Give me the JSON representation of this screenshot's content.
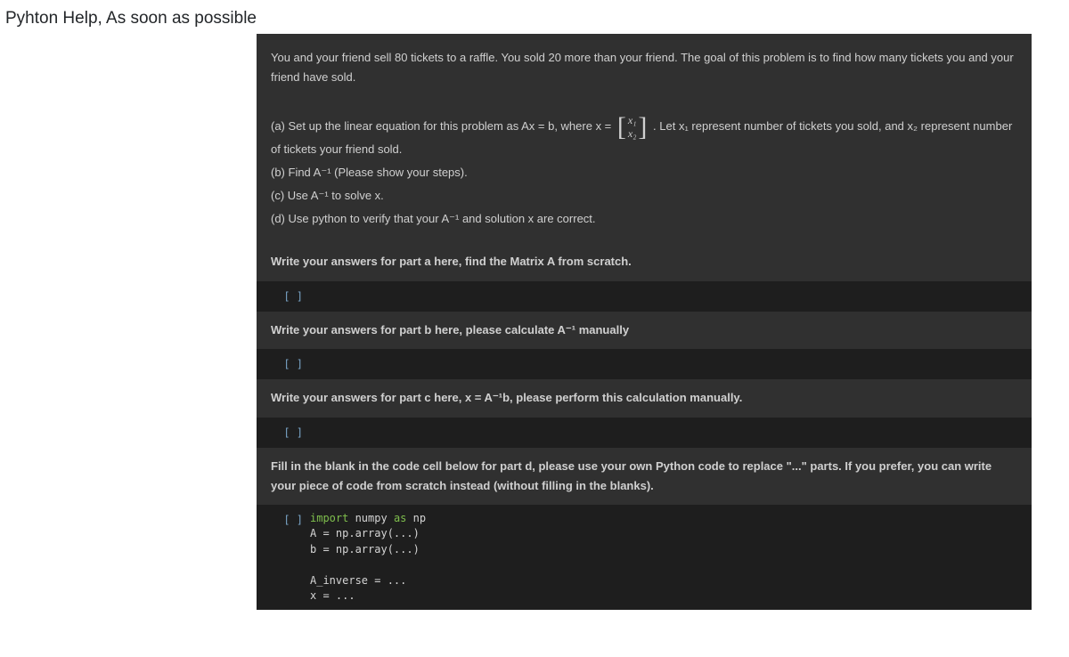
{
  "page": {
    "title": "Pyhton Help, As soon as possible"
  },
  "problem": {
    "intro": "You and your friend sell 80 tickets to a raffle. You sold 20 more than your friend. The goal of this problem is to find how many tickets you and your friend have sold.",
    "partA_pre": "(a) Set up the linear equation for this problem as Ax = b, where x =",
    "matrix_x1": "x₁",
    "matrix_x2": "x₂",
    "partA_post": ". Let x₁ represent number of tickets you sold, and x₂ represent number of tickets your friend sold.",
    "partB": "(b) Find A⁻¹ (Please show your steps).",
    "partC": "(c) Use A⁻¹ to solve x.",
    "partD": "(d) Use python to verify that your A⁻¹ and solution x are correct."
  },
  "instructions": {
    "partA": "Write your answers for part a here, find the Matrix A from scratch.",
    "partB": "Write your answers for part b here, please calculate A⁻¹ manually",
    "partC": "Write your answers for part c here, x = A⁻¹b, please perform this calculation manually.",
    "partD": "Fill in the blank in the code cell below for part d, please use your own Python code to replace \"...\" parts. If you prefer, you can write your piece of code from scratch instead (without filling in the blanks)."
  },
  "cells": {
    "prompt": "[ ]",
    "empty": "",
    "codeD": {
      "line1_kw": "import",
      "line1_mid": " numpy ",
      "line1_as": "as",
      "line1_end": " np",
      "line2": "A = np.array(...)",
      "line3": "b = np.array(...)",
      "line4": "",
      "line5": "A_inverse = ...",
      "line6": "x = ..."
    }
  }
}
